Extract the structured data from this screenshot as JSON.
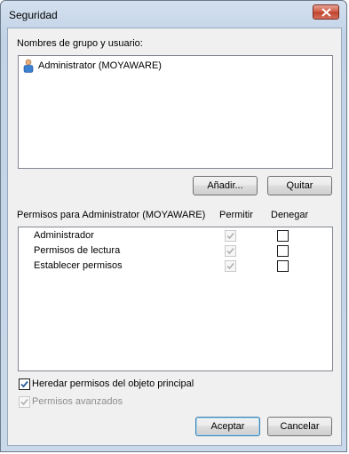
{
  "window": {
    "title": "Seguridad"
  },
  "groups": {
    "label": "Nombres de grupo y usuario:",
    "users": [
      {
        "name": "Administrator (MOYAWARE)",
        "icon": "user-icon"
      }
    ],
    "add_label": "Añadir...",
    "remove_label": "Quitar"
  },
  "permissions": {
    "label": "Permisos para Administrator (MOYAWARE)",
    "allow_header": "Permitir",
    "deny_header": "Denegar",
    "rows": [
      {
        "name": "Administrador",
        "allow": true,
        "deny": false
      },
      {
        "name": "Permisos de lectura",
        "allow": true,
        "deny": false
      },
      {
        "name": "Establecer permisos",
        "allow": true,
        "deny": false
      }
    ]
  },
  "inherit": {
    "label": "Heredar permisos del objeto principal",
    "checked": true
  },
  "advanced": {
    "label": "Permisos avanzados",
    "checked": true,
    "enabled": false
  },
  "footer": {
    "ok_label": "Aceptar",
    "cancel_label": "Cancelar"
  },
  "colors": {
    "accent": "#3c7fb1",
    "close": "#c0412d",
    "title_bg": "#c2d3e7"
  }
}
